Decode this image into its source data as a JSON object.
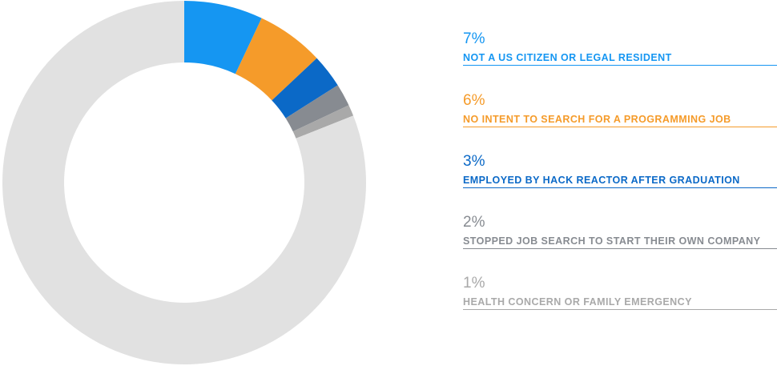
{
  "chart_data": {
    "type": "pie",
    "donut": true,
    "total_percent": 100,
    "remainder_color": "#e1e1e1",
    "slices": [
      {
        "value": 7,
        "value_label": "7%",
        "label": "NOT A US CITIZEN OR LEGAL RESIDENT",
        "color": "#1596f2"
      },
      {
        "value": 6,
        "value_label": "6%",
        "label": "NO INTENT TO SEARCH FOR A PROGRAMMING JOB",
        "color": "#f59b2a"
      },
      {
        "value": 3,
        "value_label": "3%",
        "label": "EMPLOYED BY HACK REACTOR AFTER GRADUATION",
        "color": "#0b69c7"
      },
      {
        "value": 2,
        "value_label": "2%",
        "label": "STOPPED JOB SEARCH TO START THEIR OWN COMPANY",
        "color": "#878b91"
      },
      {
        "value": 1,
        "value_label": "1%",
        "label": "HEALTH CONCERN OR FAMILY EMERGENCY",
        "color": "#a9a9a9"
      }
    ]
  }
}
